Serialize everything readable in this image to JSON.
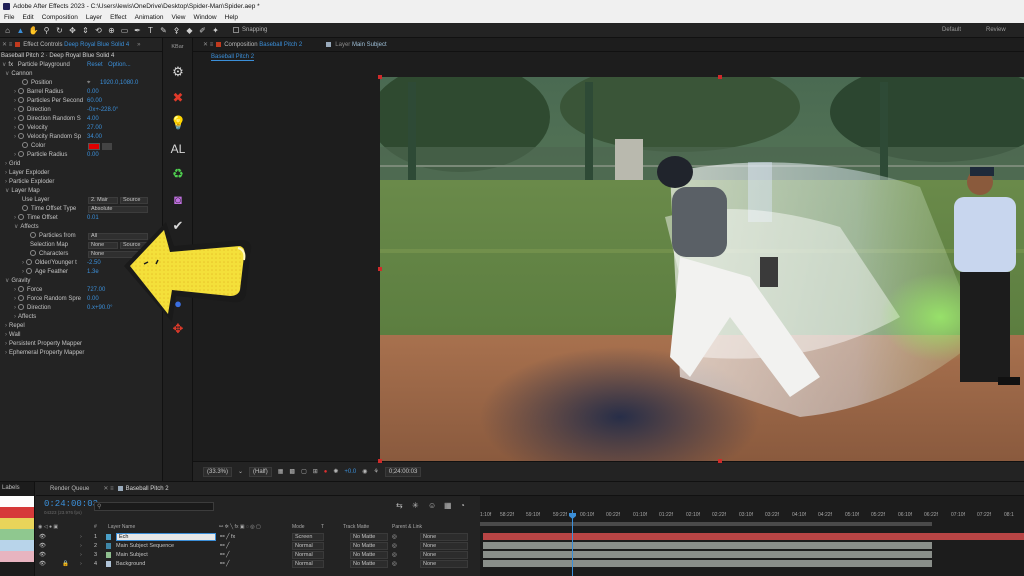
{
  "app": {
    "title": "Adobe After Effects 2023 - C:\\Users\\lewis\\OneDrive\\Desktop\\Spider-Man\\Spider.aep *",
    "menu": [
      "File",
      "Edit",
      "Composition",
      "Layer",
      "Effect",
      "Animation",
      "View",
      "Window",
      "Help"
    ],
    "snapping_label": "Snapping",
    "workspaces": [
      "Default",
      "Review"
    ]
  },
  "effect_controls": {
    "tab_prefix": "Effect Controls",
    "tab_layer": "Deep Royal Blue Solid 4",
    "breadcrumb": "Baseball Pitch 2 · Deep Royal Blue Solid 4",
    "effect_name": "Particle Playground",
    "reset_label": "Reset",
    "options_label": "Option...",
    "cannon": {
      "label": "Cannon",
      "position_label": "Position",
      "position_value": "1920.0,1080.0",
      "barrel_radius_label": "Barrel Radius",
      "barrel_radius_value": "0.00",
      "pps_label": "Particles Per Second",
      "pps_value": "60.00",
      "direction_label": "Direction",
      "direction_value": "-0x+-228.0°",
      "direction_random_label": "Direction Random S",
      "direction_random_value": "4.00",
      "velocity_label": "Velocity",
      "velocity_value": "27.00",
      "velocity_random_label": "Velocity Random Sp",
      "velocity_random_value": "34.00",
      "color_label": "Color",
      "particle_radius_label": "Particle Radius",
      "particle_radius_value": "0.00"
    },
    "grid_label": "Grid",
    "layer_exploder_label": "Layer Exploder",
    "particle_exploder_label": "Particle Exploder",
    "layer_map": {
      "label": "Layer Map",
      "use_layer_label": "Use Layer",
      "use_layer_value": "2. Mair",
      "use_layer_source": "Source",
      "time_offset_type_label": "Time Offset Type",
      "time_offset_type_value": "Absolute",
      "time_offset_label": "Time Offset",
      "time_offset_value": "0.01",
      "affects_label": "Affects",
      "particles_from_label": "Particles from",
      "particles_from_value": "All",
      "selection_map_label": "Selection Map",
      "selection_map_value": "None",
      "selection_map_source": "Source",
      "characters_label": "Characters",
      "characters_value": "None",
      "older_younger_label": "Older/Younger t",
      "older_younger_value": "-2.50",
      "age_feather_label": "Age Feather",
      "age_feather_value": "1.3e"
    },
    "gravity": {
      "label": "Gravity",
      "force_label": "Force",
      "force_value": "727.00",
      "force_random_label": "Force Random Spre",
      "force_random_value": "0.00",
      "direction_label": "Direction",
      "direction_value": "0.x+90.0°",
      "affects_label": "Affects"
    },
    "repel_label": "Repel",
    "wall_label": "Wall",
    "persistent_label": "Persistent Property Mapper",
    "ephemeral_label": "Ephemeral Property Mapper"
  },
  "tool_strip": {
    "kbar_label": "KBar",
    "al_label": "AL"
  },
  "composition": {
    "tab_prefix": "Composition",
    "tab_name": "Baseball Pitch 2",
    "layer_tab_prefix": "Layer",
    "layer_tab_name": "Main Subject",
    "sub_tab": "Baseball Pitch 2",
    "zoom": "(33.3%)",
    "resolution": "(Half)",
    "exposure": "+0.0",
    "timecode": "0;24:00:03"
  },
  "timeline": {
    "labels_tab": "Labels",
    "render_queue_tab": "Render Queue",
    "comp_tab": "Baseball Pitch 2",
    "timecode": "0:24:00:03",
    "timecode_sub": "04323 (23.976 fps)",
    "search_placeholder": "",
    "col_layer_name": "Layer Name",
    "col_mode": "Mode",
    "col_t": "T",
    "col_track_matte": "Track Matte",
    "col_parent": "Parent & Link",
    "ruler_ticks": [
      "1:10f",
      "58:22f",
      "59:10f",
      "59:22f",
      "00:10f",
      "00:22f",
      "01:10f",
      "01:22f",
      "02:10f",
      "02:22f",
      "03:10f",
      "03:22f",
      "04:10f",
      "04:22f",
      "05:10f",
      "05:22f",
      "06:10f",
      "06:22f",
      "07:10f",
      "07:22f",
      "08:1"
    ],
    "layers": [
      {
        "num": "1",
        "name": "Ech",
        "mode": "Screen",
        "matte": "No Matte",
        "parent": "None",
        "color": "#4aa0c8",
        "bar": "#b84545"
      },
      {
        "num": "2",
        "name": "Main Subject Sequence",
        "mode": "Normal",
        "matte": "No Matte",
        "parent": "None",
        "color": "#3f87a8",
        "bar": "#8a8f8a"
      },
      {
        "num": "3",
        "name": "Main Subject",
        "mode": "Normal",
        "matte": "No Matte",
        "parent": "None",
        "color": "#8fbf8f",
        "bar": "#8a8f8a"
      },
      {
        "num": "4",
        "name": "Background",
        "mode": "Normal",
        "matte": "No Matte",
        "parent": "None",
        "color": "#b0c4d8",
        "bar": "#8a8f8a"
      }
    ],
    "label_colors": [
      "#ffffff",
      "#d63a3a",
      "#e8d45a",
      "#8fc88f",
      "#b8d4ea",
      "#e8b4c0"
    ]
  },
  "colors": {
    "accent_blue": "#3b8fd9",
    "particle_color": "#e00000",
    "arrow_yellow": "#f4e03a"
  }
}
